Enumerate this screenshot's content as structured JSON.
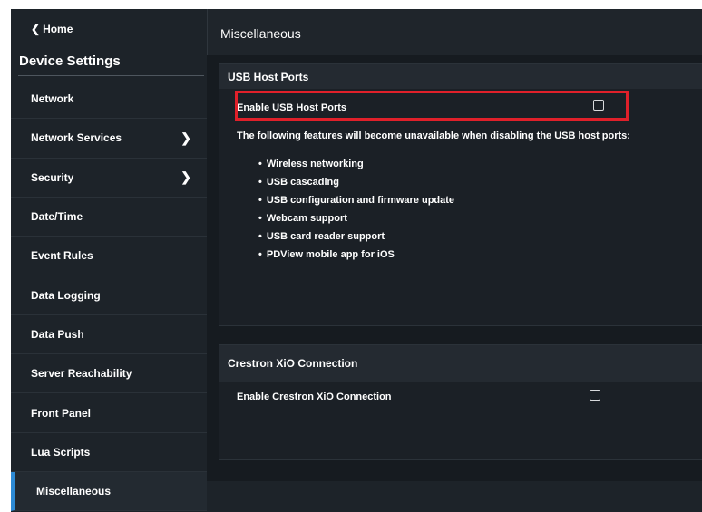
{
  "sidebar": {
    "home_label": "Home",
    "title": "Device Settings",
    "items": [
      {
        "label": "Network",
        "has_arrow": false
      },
      {
        "label": "Network Services",
        "has_arrow": true
      },
      {
        "label": "Security",
        "has_arrow": true
      },
      {
        "label": "Date/Time",
        "has_arrow": false
      },
      {
        "label": "Event Rules",
        "has_arrow": false
      },
      {
        "label": "Data Logging",
        "has_arrow": false
      },
      {
        "label": "Data Push",
        "has_arrow": false
      },
      {
        "label": "Server Reachability",
        "has_arrow": false
      },
      {
        "label": "Front Panel",
        "has_arrow": false
      },
      {
        "label": "Lua Scripts",
        "has_arrow": false
      },
      {
        "label": "Miscellaneous",
        "has_arrow": false,
        "active": true
      }
    ]
  },
  "main": {
    "title": "Miscellaneous",
    "usb_panel": {
      "header": "USB Host Ports",
      "setting_label": "Enable USB Host Ports",
      "checked": false,
      "info": "The following features will become unavailable when disabling the USB host ports:",
      "features": [
        "Wireless networking",
        "USB cascading",
        "USB configuration and firmware update",
        "Webcam support",
        "USB card reader support",
        "PDView mobile app for iOS"
      ]
    },
    "xio_panel": {
      "header": "Crestron XiO Connection",
      "setting_label": "Enable Crestron XiO Connection",
      "checked": false
    }
  },
  "colors": {
    "highlight": "#e0202a",
    "active_indicator": "#2d8ad4"
  },
  "icons": {
    "back": "chevron-left-icon",
    "submenu": "chevron-right-icon"
  }
}
